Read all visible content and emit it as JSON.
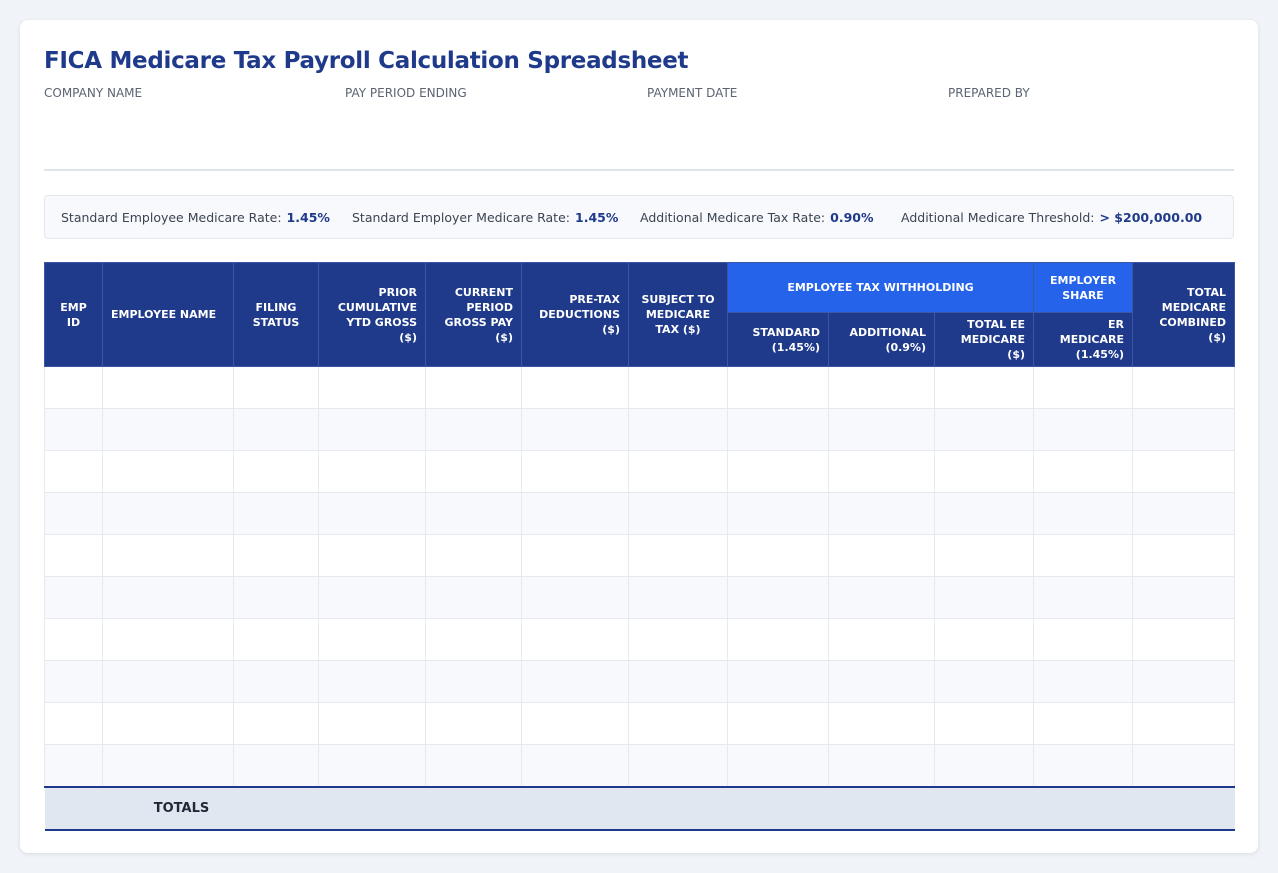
{
  "title": "FICA Medicare Tax Payroll Calculation Spreadsheet",
  "meta": {
    "company": "COMPANY NAME",
    "period": "PAY PERIOD ENDING",
    "payment_date": "PAYMENT DATE",
    "prepared_by": "PREPARED BY"
  },
  "rates": {
    "employee_label": "Standard Employee Medicare Rate:",
    "employee_value": "1.45%",
    "employer_label": "Standard Employer Medicare Rate:",
    "employer_value": "1.45%",
    "additional_label": "Additional Medicare Tax Rate:",
    "additional_value": "0.90%",
    "threshold_label": "Additional Medicare Threshold:",
    "threshold_value": "> $200,000.00"
  },
  "table": {
    "columns": {
      "emp_id": "EMP ID",
      "name": "EMPLOYEE NAME",
      "filing": "FILING STATUS",
      "prior_ytd": "PRIOR CUMULATIVE YTD GROSS ($)",
      "current_gross": "CURRENT PERIOD GROSS PAY ($)",
      "pretax": "PRE-TAX DEDUCTIONS ($)",
      "subject": "SUBJECT TO MEDICARE TAX ($)",
      "group_employee": "EMPLOYEE TAX WITHHOLDING",
      "group_employer": "EMPLOYER SHARE",
      "total_combined": "TOTAL MEDICARE COMBINED ($)",
      "standard": "STANDARD (1.45%)",
      "additional": "ADDITIONAL (0.9%)",
      "total_ee": "TOTAL EE MEDICARE ($)",
      "er_medicare": "ER MEDICARE (1.45%)"
    },
    "row_count": 10,
    "totals_label": "TOTALS"
  }
}
